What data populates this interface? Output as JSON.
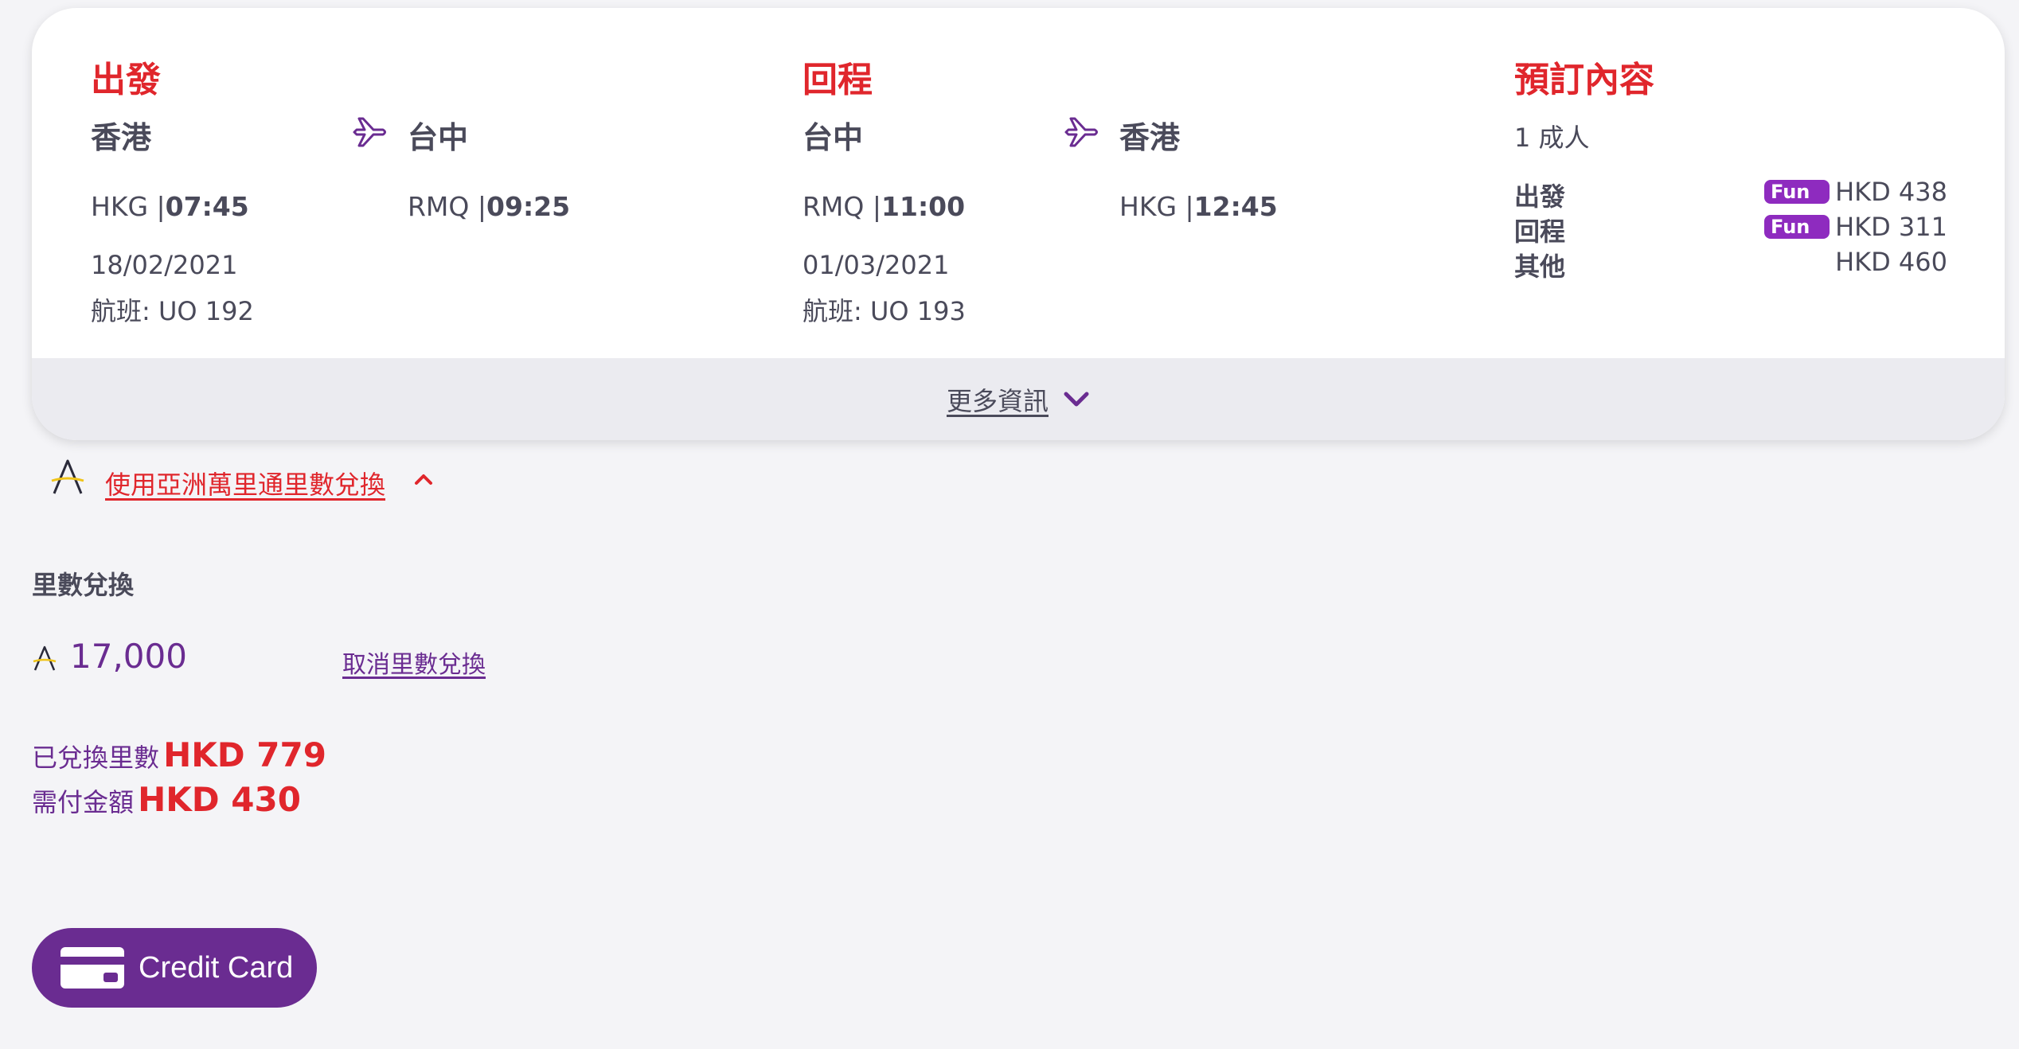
{
  "outbound": {
    "title": "出發",
    "from_city": "香港",
    "to_city": "台中",
    "from_code": "HKG",
    "from_time": "07:45",
    "to_code": "RMQ",
    "to_time": "09:25",
    "date": "18/02/2021",
    "flight": "航班: UO 192"
  },
  "return": {
    "title": "回程",
    "from_city": "台中",
    "to_city": "香港",
    "from_code": "RMQ",
    "from_time": "11:00",
    "to_code": "HKG",
    "to_time": "12:45",
    "date": "01/03/2021",
    "flight": "航班: UO 193"
  },
  "booking": {
    "title": "預訂內容",
    "passengers": "1 成人",
    "rows": [
      {
        "label": "出發",
        "badge": "Fun",
        "price": "HKD 438"
      },
      {
        "label": "回程",
        "badge": "Fun",
        "price": "HKD 311"
      },
      {
        "label": "其他",
        "badge": "",
        "price": "HKD 460"
      }
    ]
  },
  "more_info": "更多資訊",
  "asia_miles_link": "使用亞洲萬里通里數兌換",
  "redeem": {
    "title": "里數兌換",
    "miles": "17,000",
    "cancel": "取消里數兌換",
    "redeemed_label": "已兌換里數",
    "redeemed_value": "HKD 779",
    "payable_label": "需付金額",
    "payable_value": "HKD 430"
  },
  "payment": {
    "credit_card_label": "Credit Card"
  },
  "colors": {
    "accent_red": "#e0262c",
    "brand_purple": "#6a2c91",
    "badge_purple": "#8e2bbf",
    "text": "#4a4a5a"
  }
}
